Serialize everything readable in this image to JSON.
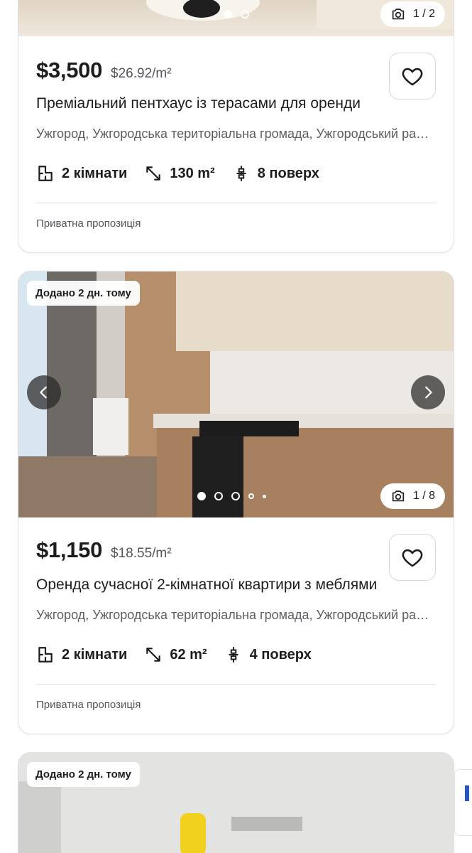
{
  "listings": [
    {
      "photo_counter": "1 / 2",
      "price": "$3,500",
      "price_per_m2": "$26.92/m²",
      "title": "Преміальний пентхаус із терасами для оренди",
      "address": "Ужгород, Ужгородська територіальна громада, Ужгородський район",
      "rooms": "2 кімнати",
      "area": "130 m²",
      "floor": "8 поверх",
      "seller": "Приватна пропозиція"
    },
    {
      "badge": "Додано 2 дн. тому",
      "photo_counter": "1 / 8",
      "price": "$1,150",
      "price_per_m2": "$18.55/m²",
      "title": "Оренда сучасної 2-кімнатної квартири з меблями",
      "address": "Ужгород, Ужгородська територіальна громада, Ужгородський район",
      "rooms": "2 кімнати",
      "area": "62 m²",
      "floor": "4 поверх",
      "seller": "Приватна пропозиція"
    },
    {
      "badge": "Додано 2 дн. тому"
    }
  ],
  "icons": {
    "camera": "camera-icon",
    "heart": "heart-icon",
    "rooms": "floorplan-icon",
    "area": "area-diagonal-icon",
    "floor": "floor-level-icon",
    "prev": "chevron-left-icon",
    "next": "chevron-right-icon"
  },
  "colors": {
    "text": "#1d1d1f",
    "muted": "#5d5d64",
    "border": "#e1e1e6",
    "accent": "#2353c8"
  }
}
